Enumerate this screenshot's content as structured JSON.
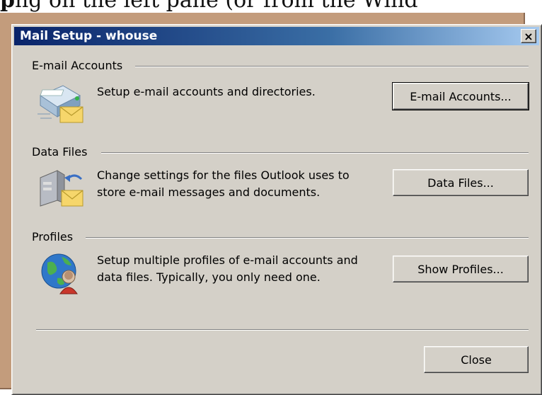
{
  "document": {
    "visible_text_bold": "p",
    "visible_text": "ng on the left pane (or from the Wind"
  },
  "dialog": {
    "title": "Mail Setup - whouse",
    "close_glyph": "×"
  },
  "sections": [
    {
      "label": "E-mail Accounts",
      "description": "Setup e-mail accounts and directories.",
      "button": "E-mail Accounts...",
      "icon": "email-accounts-icon"
    },
    {
      "label": "Data Files",
      "description_line1": "Change settings for the files Outlook uses to",
      "description_line2": "store e-mail messages and documents.",
      "button": "Data Files...",
      "icon": "data-files-icon"
    },
    {
      "label": "Profiles",
      "description_line1": "Setup multiple profiles of e-mail accounts and",
      "description_line2": "data files. Typically, you only need one.",
      "button": "Show Profiles...",
      "icon": "profiles-icon"
    }
  ],
  "footer": {
    "close_button": "Close"
  },
  "colors": {
    "dialog_face": "#d4d0c8",
    "titlebar_start": "#0a246a",
    "titlebar_end": "#a6caf0",
    "backdrop": "#c39c7c"
  }
}
